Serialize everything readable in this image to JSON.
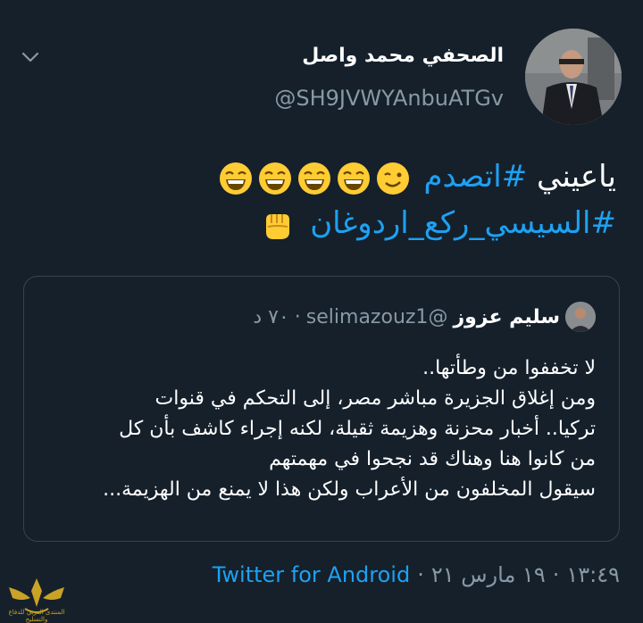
{
  "author": {
    "display_name": "الصحفي محمد واصل",
    "handle": "@SH9JVWYAnbuATGv",
    "avatar_icon": "profile-photo-man-in-suit"
  },
  "tweet": {
    "prefix": "ياعيني",
    "hashtag1": "#اتصدم",
    "hashtag2": "#السيسي_ركع_اردوغان",
    "emojis": [
      "wink-emoji",
      "laughing-emoji",
      "laughing-emoji",
      "laughing-emoji",
      "laughing-emoji",
      "fist-emoji"
    ]
  },
  "quote": {
    "name": "سليم عزوز",
    "handle": "@selimazouz1",
    "dot": "·",
    "time": "٧٠ د",
    "lines": [
      "لا تخففوا من وطأتها..",
      "ومن إغلاق الجزيرة مباشر مصر، إلى التحكم في قنوات",
      "تركيا.. أخبار محزنة وهزيمة ثقيلة، لكنه إجراء كاشف بأن كل",
      "من كانوا هنا وهناك قد نجحوا في مهمتهم",
      "سيقول المخلفون من الأعراب ولكن هذا لا يمنع من الهزيمة..."
    ]
  },
  "meta": {
    "time": "١٣:٤٩",
    "sep1": "·",
    "date": "١٩ مارس ٢١",
    "sep2": "·",
    "source": "Twitter for Android"
  },
  "watermark": {
    "text": "المنتدى العربي للدفاع والتسليح"
  },
  "colors": {
    "background": "#15202b",
    "accent": "#1da1f2",
    "muted": "#8899a6",
    "border": "#38444d"
  }
}
